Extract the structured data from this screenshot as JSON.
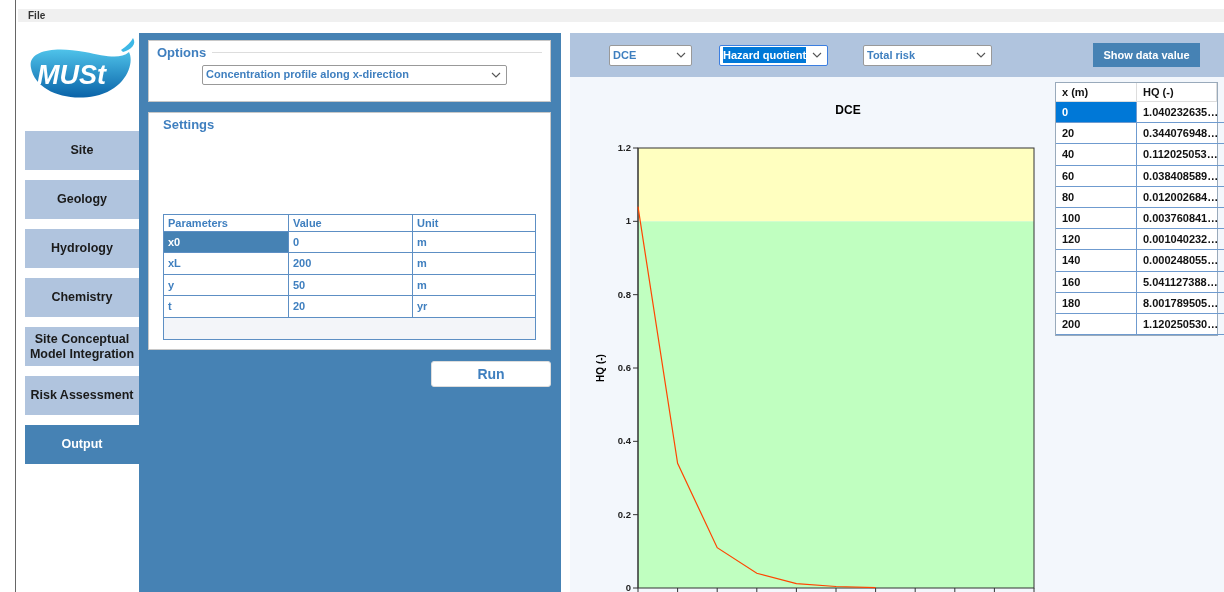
{
  "menu": [
    "File"
  ],
  "logo": {
    "text": "MUSt"
  },
  "nav": [
    {
      "label": "Site",
      "selected": false
    },
    {
      "label": "Geology",
      "selected": false
    },
    {
      "label": "Hydrology",
      "selected": false
    },
    {
      "label": "Chemistry",
      "selected": false
    },
    {
      "label": "Site Conceptual Model Integration",
      "selected": false
    },
    {
      "label": "Risk Assessment",
      "selected": false
    },
    {
      "label": "Output",
      "selected": true
    }
  ],
  "options": {
    "title": "Options",
    "dropdown": {
      "value": "Concentration profile along x-direction"
    }
  },
  "settings": {
    "title": "Settings",
    "columns": [
      "Parameters",
      "Value",
      "Unit"
    ],
    "rows": [
      {
        "cells": [
          "x0",
          "0",
          "m"
        ],
        "selected": true
      },
      {
        "cells": [
          "xL",
          "200",
          "m"
        ],
        "selected": false
      },
      {
        "cells": [
          "y",
          "50",
          "m"
        ],
        "selected": false
      },
      {
        "cells": [
          "t",
          "20",
          "yr"
        ],
        "selected": false
      }
    ]
  },
  "run_button": "Run",
  "toolbar": {
    "dropdowns": [
      {
        "value": "DCE",
        "focused": false
      },
      {
        "value": "Hazard quotient",
        "focused": true
      },
      {
        "value": "Total risk",
        "focused": false
      }
    ],
    "button": "Show data value"
  },
  "chart": {
    "chart_data": {
      "type": "line",
      "title": "DCE",
      "ylabel": "HQ (-)",
      "categories": [
        null,
        null,
        null,
        null,
        null,
        null,
        null,
        null,
        null,
        null,
        null
      ],
      "series": [
        {
          "color": "#ff4500",
          "values": [
            1.04,
            0.34,
            0.11,
            0.04,
            0.012,
            0.004,
            0.001,
            null,
            null,
            null,
            null
          ]
        }
      ],
      "ylim": [
        0,
        1.2
      ],
      "yticks": [
        0,
        0.2,
        0.4,
        0.6,
        0.8,
        1,
        1.2
      ],
      "bands": [
        {
          "axis": "y",
          "from": 1,
          "to": 1.2,
          "color": "#ffffc0"
        },
        {
          "axis": "y",
          "from": 0,
          "to": 1,
          "color": "#c0ffc0"
        }
      ]
    }
  },
  "data_table": {
    "columns": [
      "x (m)",
      "HQ (-)"
    ],
    "rows": [
      {
        "cells": [
          "0",
          "1.040232635…"
        ],
        "selected": true
      },
      {
        "cells": [
          "20",
          "0.344076948…"
        ],
        "selected": false
      },
      {
        "cells": [
          "40",
          "0.112025053…"
        ],
        "selected": false
      },
      {
        "cells": [
          "60",
          "0.038408589…"
        ],
        "selected": false
      },
      {
        "cells": [
          "80",
          "0.012002684…"
        ],
        "selected": false
      },
      {
        "cells": [
          "100",
          "0.003760841…"
        ],
        "selected": false
      },
      {
        "cells": [
          "120",
          "0.001040232…"
        ],
        "selected": false
      },
      {
        "cells": [
          "140",
          "0.000248055…"
        ],
        "selected": false
      },
      {
        "cells": [
          "160",
          "5.041127388…"
        ],
        "selected": false
      },
      {
        "cells": [
          "180",
          "8.001789505…"
        ],
        "selected": false
      },
      {
        "cells": [
          "200",
          "1.120250530…"
        ],
        "selected": false
      }
    ]
  }
}
